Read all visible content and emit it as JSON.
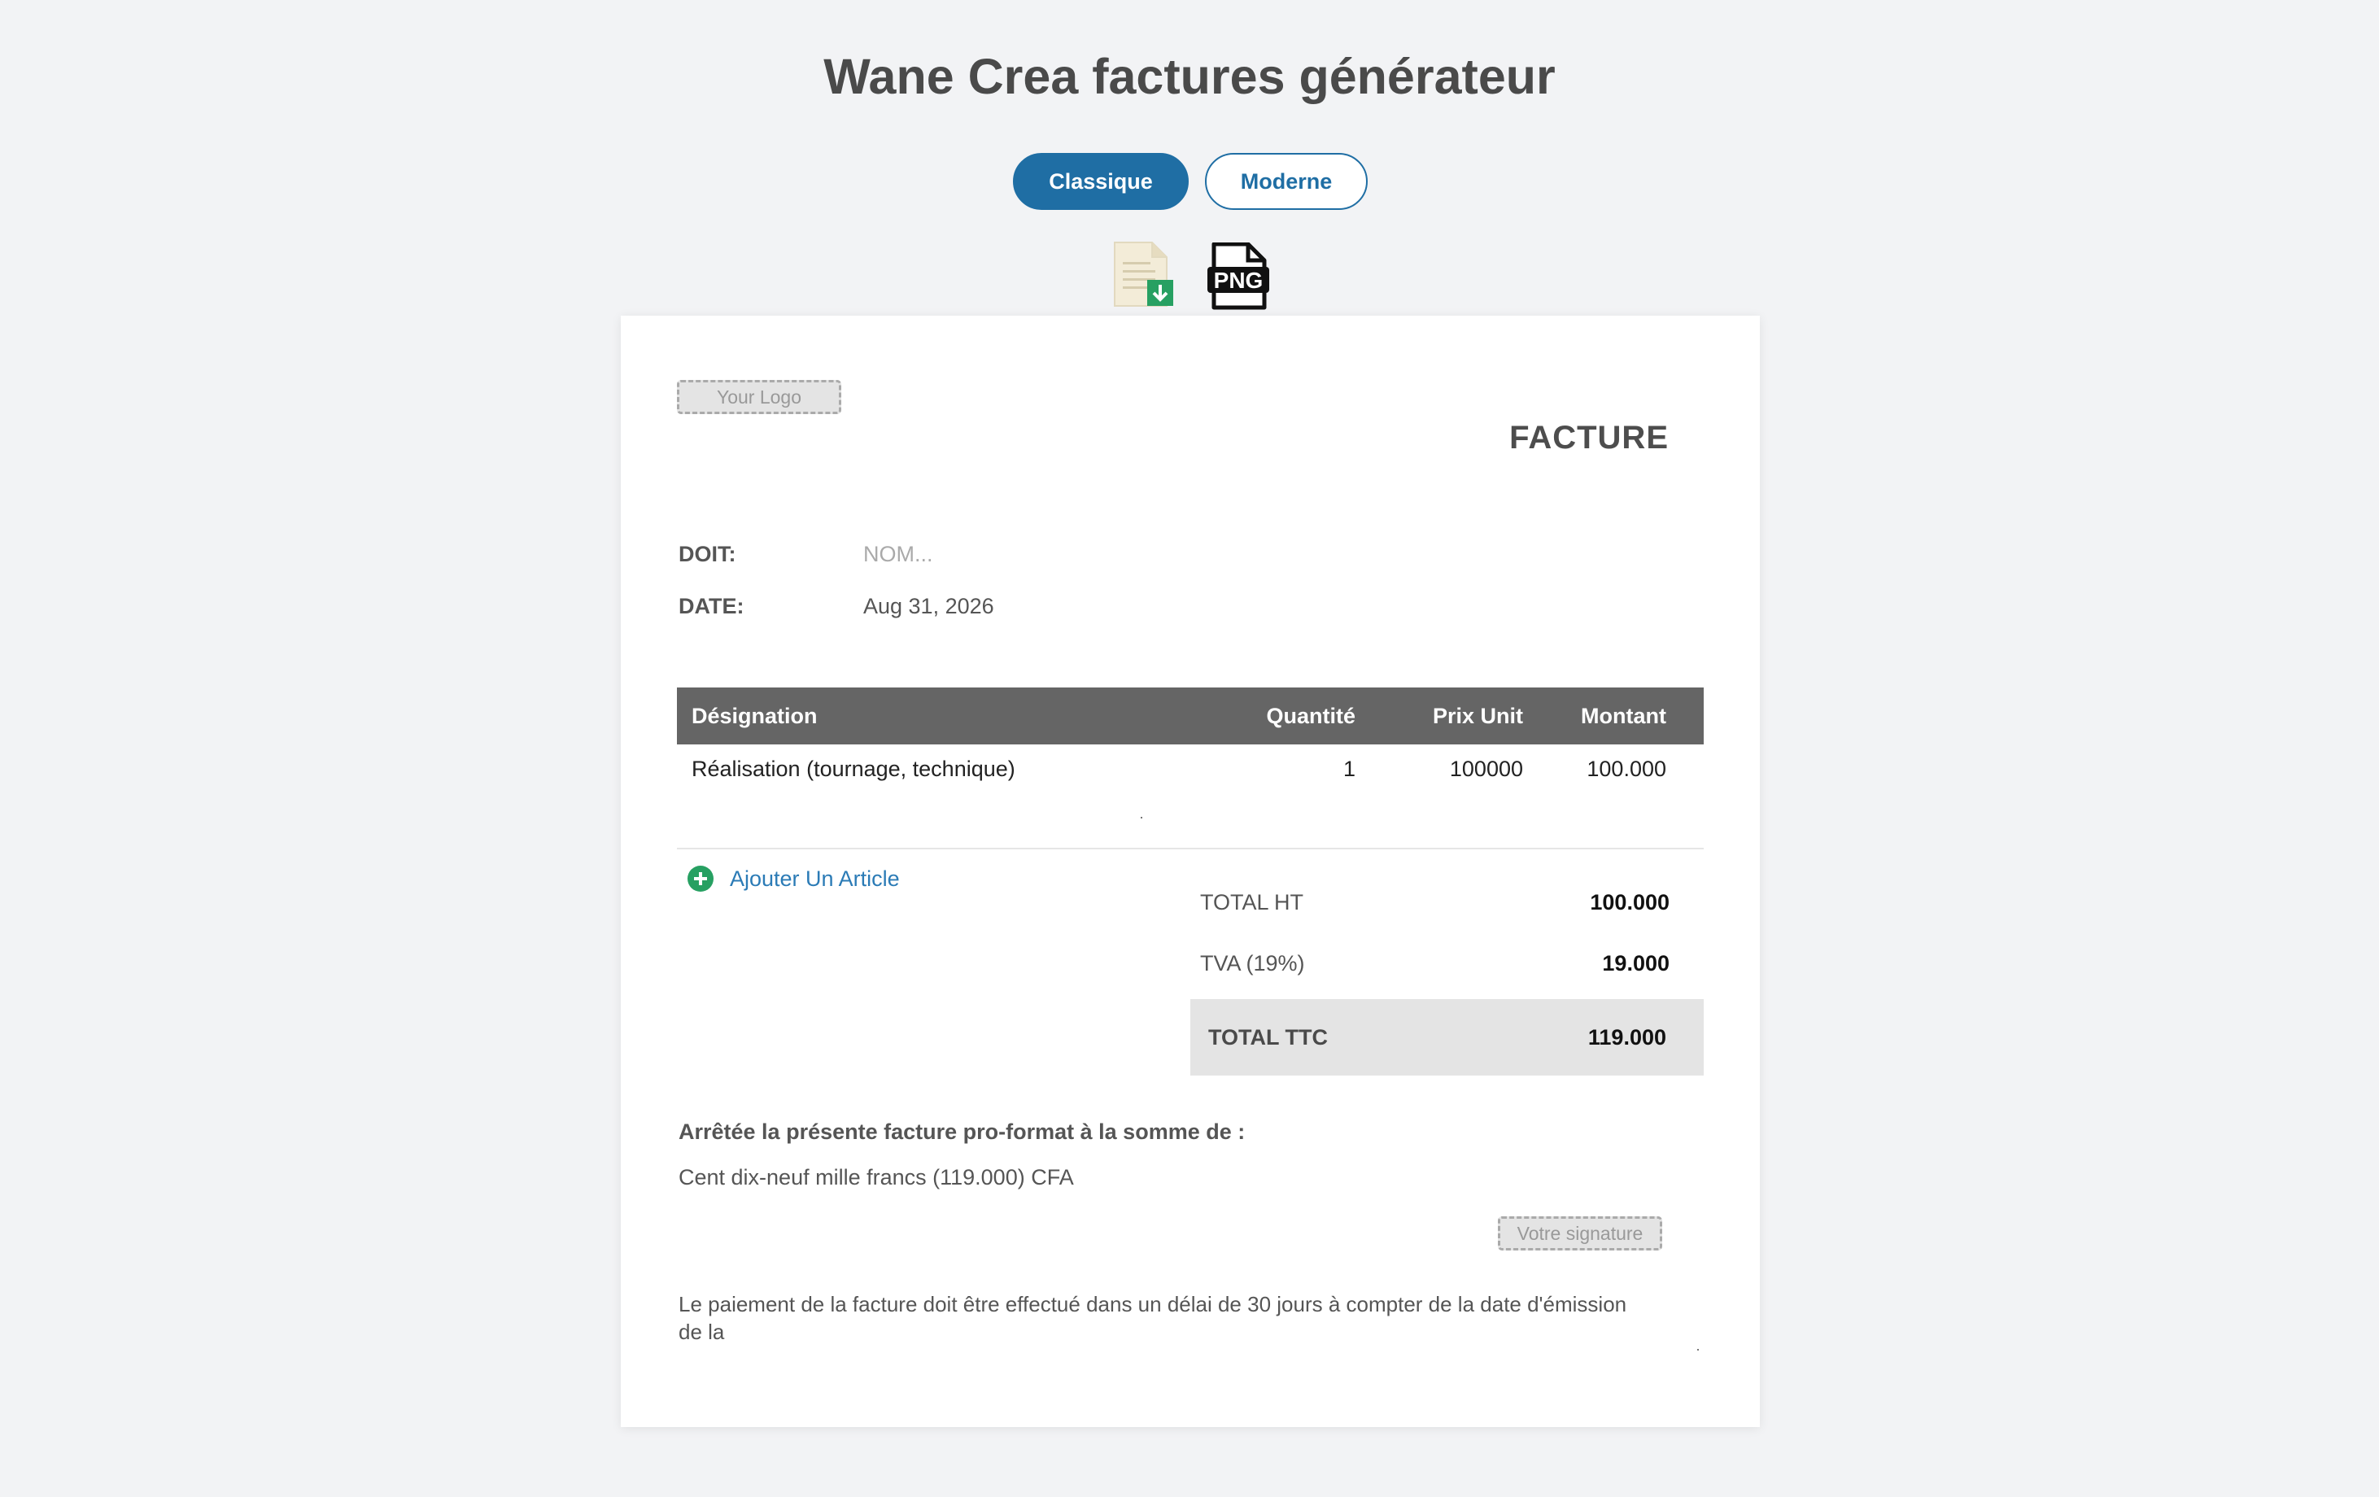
{
  "app": {
    "title": "Wane Crea factures générateur"
  },
  "template_switch": {
    "classic_label": "Classique",
    "modern_label": "Moderne",
    "selected": "Classique"
  },
  "export": {
    "document_icon": "document-download-icon",
    "png_icon": "png-file-icon",
    "png_label": "PNG"
  },
  "invoice": {
    "logo_placeholder": "Your Logo",
    "title": "FACTURE",
    "doit_label": "DOIT:",
    "doit_placeholder": "NOM...",
    "date_label": "DATE:",
    "date_value": "Aug 31, 2026",
    "table": {
      "headers": {
        "designation": "Désignation",
        "quantity": "Quantité",
        "unit_price": "Prix Unit",
        "amount": "Montant"
      },
      "rows": [
        {
          "designation": "Réalisation (tournage, technique)",
          "quantity": "1",
          "unit_price": "100000",
          "amount": "100.000"
        }
      ]
    },
    "add_item_label": "Ajouter Un Article",
    "totals": {
      "ht_label": "TOTAL HT",
      "ht_value": "100.000",
      "tva_label": "TVA (19%)",
      "tva_value": "19.000",
      "ttc_label": "TOTAL TTC",
      "ttc_value": "119.000"
    },
    "amount_heading": "Arrêtée la présente facture pro-format à la somme de :",
    "amount_words": "Cent dix-neuf mille francs (119.000) CFA",
    "signature_placeholder": "Votre signature",
    "payment_terms": "Le paiement de la facture doit être effectué dans un délai de 30 jours à compter de la date d'émission de la"
  },
  "colors": {
    "primary": "#1f6ea4",
    "table_header": "#656565",
    "add_icon": "#27a062",
    "background": "#f2f3f5"
  }
}
